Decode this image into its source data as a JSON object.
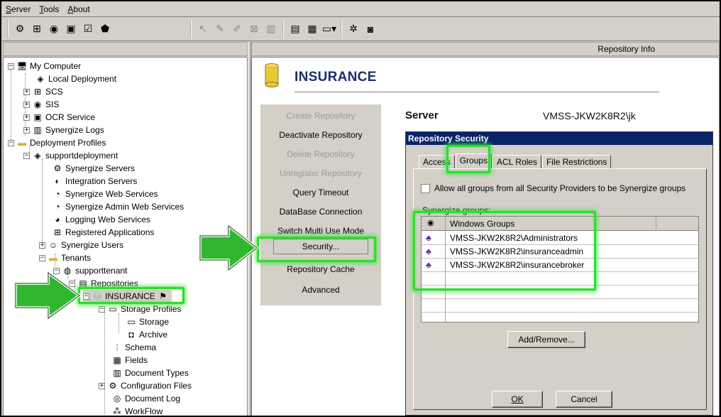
{
  "menu": [
    "Server",
    "Tools",
    "About"
  ],
  "toolbar": {
    "icons": [
      "server-icon",
      "network-icon",
      "sis-icon",
      "book-icon",
      "checklist-icon",
      "profile-icon",
      "select-icon",
      "edit-icon",
      "edit-multi-icon",
      "disable-icon",
      "document-icon",
      "layout-icon",
      "window-icon",
      "monitor-icon",
      "settings-icon",
      "lock-icon"
    ]
  },
  "right_header": "Repository Info",
  "tree": {
    "items": [
      "My Computer",
      "Local Deployment",
      "SCS",
      "SIS",
      "OCR Service",
      "Synergize Logs",
      "Deployment Profiles",
      "supportdeployment",
      "Synergize Servers",
      "Integration Servers",
      "Synergize Web Services",
      "Synergize Admin Web Services",
      "Logging Web Services",
      "Registered Applications",
      "Synergize Users",
      "Tenants",
      "supporttenant",
      "Repositories",
      "INSURANCE",
      "Storage Profiles",
      "Storage",
      "Archive",
      "Schema",
      "Fields",
      "Document Types",
      "Configuration Files",
      "Document Log",
      "WorkFlow"
    ]
  },
  "repository": {
    "title": "INSURANCE",
    "actions": [
      {
        "label": "Create Repository",
        "enabled": false
      },
      {
        "label": "Deactivate Repository",
        "enabled": true
      },
      {
        "label": "Delete Repository",
        "enabled": false
      },
      {
        "label": "Unregister Repository",
        "enabled": false
      },
      {
        "label": "Query Timeout",
        "enabled": true
      },
      {
        "label": "DataBase Connection",
        "enabled": true
      },
      {
        "label": "Switch Multi Use Mode",
        "enabled": true
      },
      {
        "label": "Security...",
        "enabled": true
      },
      {
        "label": "Repository Cache",
        "enabled": true
      },
      {
        "label": "Advanced",
        "enabled": true
      }
    ],
    "server_label": "Server",
    "server_value": "VMSS-JKW2K8R2\\jk"
  },
  "dialog": {
    "title": "Repository Security",
    "tabs": [
      "Access",
      "Groups",
      "ACL Roles",
      "File Restrictions"
    ],
    "active_tab": "Groups",
    "checkbox_label": "Allow all groups from all Security Providers to be Synergize groups",
    "groups_label": "Synergize groups:",
    "column_header": "Windows Groups",
    "rows": [
      "VMSS-JKW2K8R2\\Administrators",
      "VMSS-JKW2K8R2\\insuranceadmin",
      "VMSS-JKW2K8R2\\insurancebroker"
    ],
    "add_remove": "Add/Remove...",
    "ok": "OK",
    "cancel": "Cancel"
  },
  "colors": {
    "highlight": "#2fdc2f",
    "title_bar": "#0a246a",
    "header_text": "#1a2f6b"
  }
}
